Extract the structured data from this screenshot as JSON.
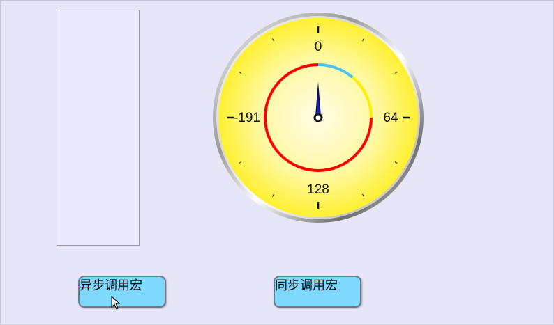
{
  "gauge": {
    "labels": {
      "top": "0",
      "right": "64",
      "bottom": "128",
      "left": "-191"
    },
    "needle_value": 0,
    "colors": {
      "face_center": "#fffde8",
      "face_edge": "#fff24a",
      "red_band": "#ff0000",
      "blue_band": "#4ec3f0",
      "yellow_band": "#ffee00",
      "needle": "#0a0a6a"
    }
  },
  "buttons": {
    "async_label": "异步调用宏",
    "sync_label": "同步调用宏"
  },
  "theme": {
    "background": "#e6e6f8",
    "button_fill": "#7fd8fd"
  }
}
